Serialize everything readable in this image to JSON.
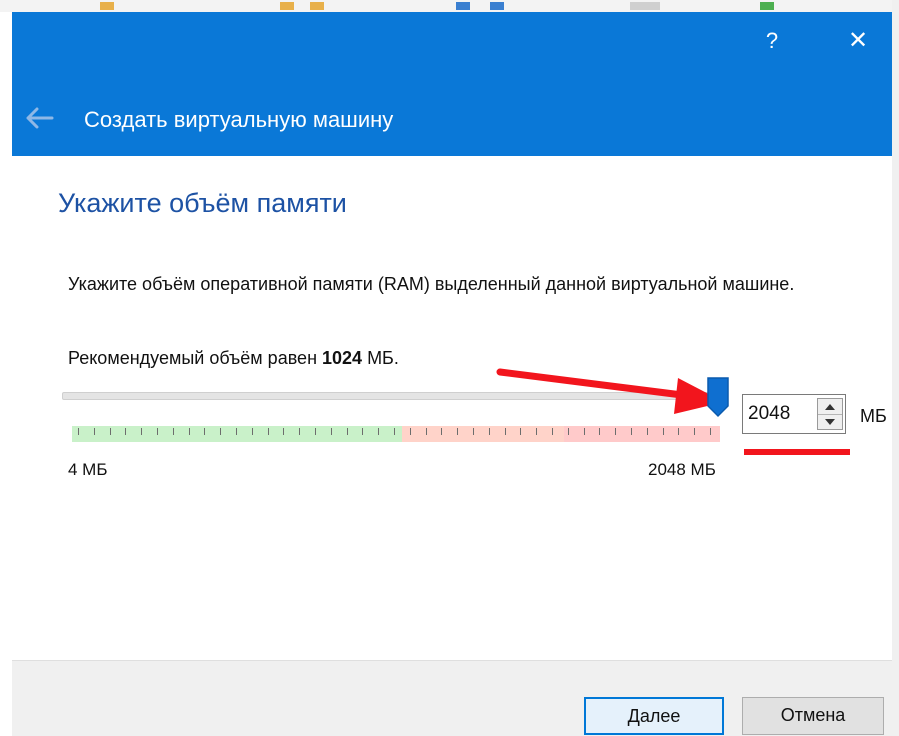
{
  "window": {
    "help_label": "?",
    "close_label": "✕",
    "title": "Создать виртуальную машину",
    "accent_color": "#0a78d7"
  },
  "page": {
    "heading": "Укажите объём памяти",
    "description": "Укажите объём оперативной памяти (RAM) выделенный данной виртуальной машине.",
    "recommend_prefix": "Рекомендуемый объём равен ",
    "recommend_value": "1024",
    "recommend_suffix": " МБ."
  },
  "memory": {
    "min_label": "4 МБ",
    "max_label": "2048 МБ",
    "value": "2048",
    "unit": "МБ",
    "slider_fraction": 1.0,
    "zone_colors": [
      "#c9f1c9",
      "#ffd3c9",
      "#ffcaca"
    ]
  },
  "buttons": {
    "next": "Далее",
    "cancel": "Отмена"
  },
  "annotations": {
    "arrow_color": "#f2151d",
    "underline_color": "#f2151d"
  }
}
